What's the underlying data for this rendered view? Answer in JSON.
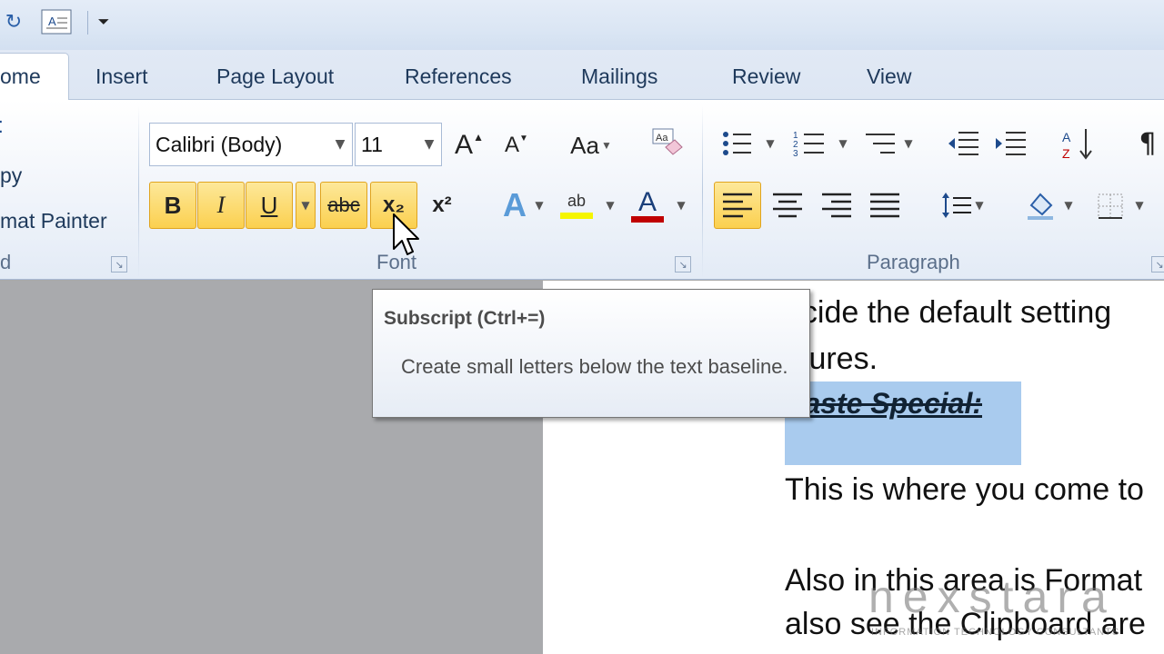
{
  "tabs": [
    {
      "label": "ome",
      "active": true
    },
    {
      "label": "Insert"
    },
    {
      "label": "Page Layout"
    },
    {
      "label": "References"
    },
    {
      "label": "Mailings"
    },
    {
      "label": "Review"
    },
    {
      "label": "View"
    }
  ],
  "clipboard": {
    "copy_label": "py",
    "format_painter_label": "mat Painter",
    "group_label": "d"
  },
  "font": {
    "font_name": "Calibri (Body)",
    "font_size": "11",
    "change_case_label": "Aa",
    "bold_label": "B",
    "italic_label": "I",
    "underline_label": "U",
    "strike_label": "abc",
    "subscript_label": "x₂",
    "superscript_label": "x²",
    "highlight_label": "ab",
    "font_color_label": "A",
    "group_label": "Font"
  },
  "paragraph": {
    "show_marks_label": "¶",
    "group_label": "Paragraph"
  },
  "tooltip": {
    "title": "Subscript (Ctrl+=)",
    "body": "Create small letters below the text baseline."
  },
  "document": {
    "line1": "ecide the default setting",
    "line2": "ctures.",
    "heading": "Paste Special:",
    "line3": "This is where you come to",
    "line4": "Also in this area is Format",
    "line5": "also see the Clipboard are"
  },
  "watermark": {
    "brand": "nexstara",
    "tagline": "INFORMATION TECHNOLOGY CONSULTANTS"
  },
  "colors": {
    "highlight": "#f5f500",
    "font_color": "#c00000",
    "selection": "#a9cbee",
    "active_button": "#fbd04f"
  }
}
